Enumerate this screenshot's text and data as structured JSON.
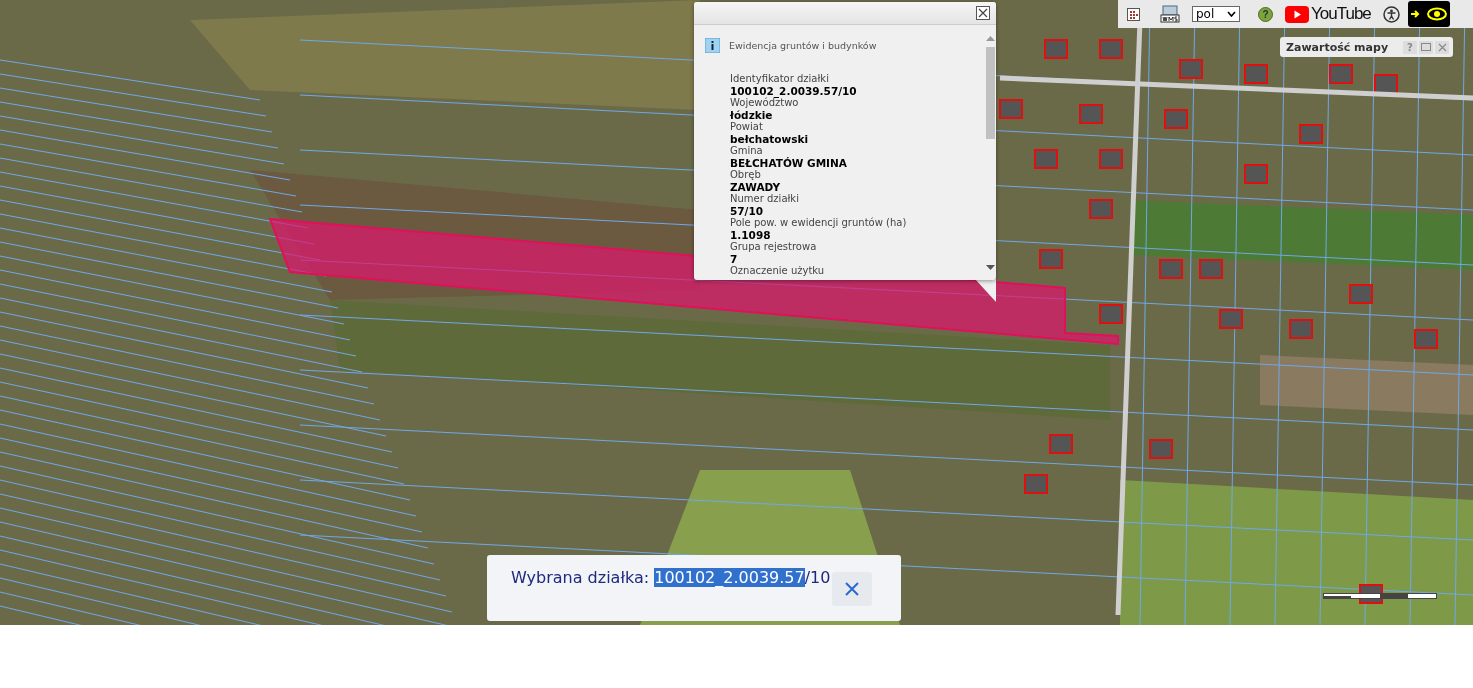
{
  "popup": {
    "title": "Ewidencja gruntów i budynków",
    "fields": [
      {
        "label": "Identyfikator działki",
        "value": "100102_2.0039.57/10"
      },
      {
        "label": "Województwo",
        "value": "łódzkie"
      },
      {
        "label": "Powiat",
        "value": "bełchatowski"
      },
      {
        "label": "Gmina",
        "value": "BEŁCHATÓW GMINA"
      },
      {
        "label": "Obręb",
        "value": "ZAWADY"
      },
      {
        "label": "Numer działki",
        "value": "57/10"
      },
      {
        "label": "Pole pow. w ewidencji gruntów (ha)",
        "value": "1.1098"
      },
      {
        "label": "Grupa rejestrowa",
        "value": "7"
      },
      {
        "label": "Oznaczenie użytku"
      }
    ]
  },
  "toolbar": {
    "language": "pol",
    "help": "?",
    "video_logo": "YouTube"
  },
  "layers_panel": {
    "title": "Zawartość mapy",
    "help": "?"
  },
  "selection": {
    "label": "Wybrana działka:",
    "value_selected": "100102_2.0039.57",
    "value_rest": "/10"
  }
}
